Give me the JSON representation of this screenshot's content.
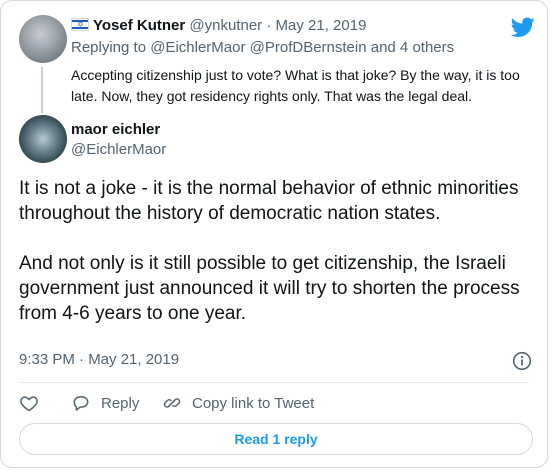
{
  "parent": {
    "name": "Yosef Kutner",
    "handle": "@ynkutner",
    "separator": " · ",
    "date": "May 21, 2019",
    "replying_to": "Replying to @EichlerMaor @ProfDBernstein and 4 others",
    "text": "Accepting citizenship just to vote? What is that joke? By the way, it is too late. Now, they got residency rights only. That was the legal deal."
  },
  "tweet": {
    "name": "maor eichler",
    "handle": "@EichlerMaor",
    "text": "It is not a joke - it is the normal behavior of ethnic minorities throughout the history of democratic nation states.\n\nAnd not only is it still possible to get citizenship, the Israeli government just announced it will try to shorten the process from 4-6 years to one year.",
    "timestamp": "9:33 PM · May 21, 2019"
  },
  "actions": {
    "like_icon": "heart-icon",
    "reply_label": "Reply",
    "copy_label": "Copy link to Tweet"
  },
  "read_replies_label": "Read 1 reply",
  "colors": {
    "accent": "#1d9bf0",
    "text": "#0f1419",
    "muted": "#536471",
    "border": "#cfd9de"
  }
}
